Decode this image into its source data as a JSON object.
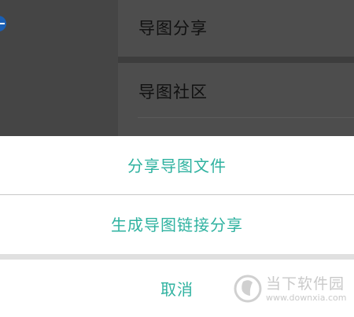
{
  "background_menu": {
    "items": [
      {
        "label": "导图分享"
      },
      {
        "label": "导图社区"
      }
    ]
  },
  "action_sheet": {
    "share_file_label": "分享导图文件",
    "generate_link_label": "生成导图链接分享",
    "cancel_label": "取消"
  },
  "watermark": {
    "title": "当下软件园",
    "url": "www.downxia.com"
  },
  "colors": {
    "accent": "#2fb2a0",
    "overlay": "#4b4b4b",
    "separator": "#c8c8c8"
  }
}
